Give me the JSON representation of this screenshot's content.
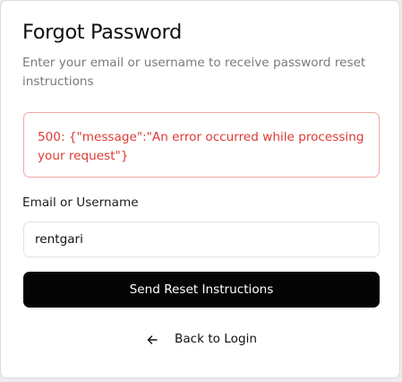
{
  "form": {
    "title": "Forgot Password",
    "subtitle": "Enter your email or username to receive password reset instructions",
    "error_message": "500: {\"message\":\"An error occurred while processing your request\"}",
    "field_label": "Email or Username",
    "field_value": "rentgari",
    "submit_label": "Send Reset Instructions",
    "back_label": "Back to Login",
    "back_icon": "arrow-left-icon"
  },
  "colors": {
    "error_text": "#dc3a34",
    "error_border": "#f1a7a4",
    "button_bg": "#050505",
    "button_text": "#ffffff"
  }
}
